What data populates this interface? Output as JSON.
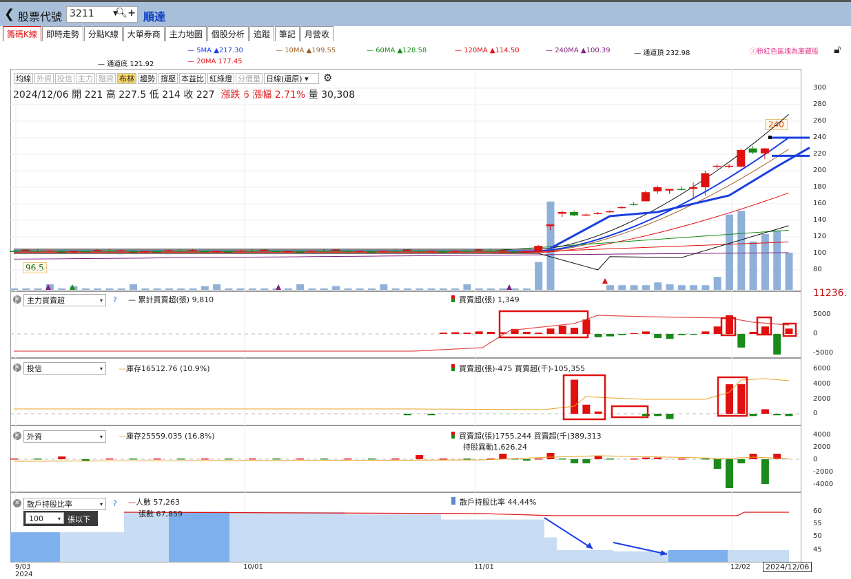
{
  "header": {
    "back": "❮",
    "label": "股票代號",
    "code": "3211",
    "name": "順達"
  },
  "tabs": [
    "籌碼K線",
    "即時走勢",
    "分點K線",
    "大單券商",
    "主力地圖",
    "個股分析",
    "追蹤",
    "筆記",
    "月營收"
  ],
  "ma_legend": {
    "ma5": "5MA ▲217.30",
    "ma10": "10MA ▲199.55",
    "ma60": "60MA ▲128.58",
    "ma120": "120MA ▲114.50",
    "ma240": "240MA ▲100.39",
    "channel_top": "通道頂 232.98",
    "channel_bottom": "通道底 121.92",
    "ma20": "20MA 177.45"
  },
  "warning": "ⓘ粉紅色區塊為庫藏股",
  "toolbar": [
    "均線",
    "外資",
    "投信",
    "主力",
    "融資",
    "布林",
    "趨勢",
    "撐壓",
    "本益比",
    "紅綠燈",
    "分價量",
    "日線(還原)"
  ],
  "ohlc": {
    "date": "2024/12/06",
    "open": "開 221",
    "high": "高 227.5",
    "low": "低 214",
    "close": "收 227",
    "change": "漲跌 6",
    "pct": "漲幅 2.71%",
    "vol": "量 30,308"
  },
  "price_labels": {
    "high_tag": "240",
    "low_tag": "96.5"
  },
  "price_axis": [
    "300",
    "280",
    "260",
    "240",
    "220",
    "200",
    "180",
    "160",
    "140",
    "120",
    "100",
    "80"
  ],
  "panel1": {
    "select": "主力買賣超",
    "q": "?",
    "legend": "累計買賣超(張) 9,810",
    "right": "買賣超(張) 1,349",
    "axis": [
      "5000",
      "0",
      "-5000"
    ],
    "edge": "11236."
  },
  "panel2": {
    "select": "投信",
    "legend": "庫存16512.76 (10.9%)",
    "right": "買賣超(張)-475 買賣超(千)-105,355",
    "axis": [
      "6000",
      "4000",
      "2000",
      "0"
    ]
  },
  "panel3": {
    "select": "外資",
    "legend": "庫存25559.035 (16.8%)",
    "right": "買賣超(張)1755.244 買賣超(千)389,313",
    "right2": "持股異動1,626.24",
    "axis": [
      "4000",
      "2000",
      "0",
      "-2000",
      "-4000"
    ]
  },
  "panel4": {
    "select": "散戶持股比率",
    "q": "?",
    "sub_select": "100",
    "sub_label": "張以下",
    "legend1": "人數 57,263",
    "legend2": "張數 67,859",
    "right": "散戶持股比率 44.44%",
    "axis": [
      "60",
      "55",
      "50",
      "45"
    ]
  },
  "x_dates": {
    "d1": "9/03",
    "d1y": "2024",
    "d2": "10/01",
    "d3": "11/01",
    "d4": "12/02",
    "current": "2024/12/06"
  },
  "colors": {
    "up": "#e01010",
    "down": "#1a8a1a",
    "volume": "#8fb0d8",
    "annotation": "#1a3ee0",
    "box": "#e01010"
  },
  "chart_data": {
    "type": "candlestick",
    "candles": [
      {
        "o": 175,
        "h": 182,
        "l": 172,
        "c": 180
      },
      {
        "o": 176,
        "h": 178,
        "l": 172,
        "c": 178
      },
      {
        "o": 178,
        "h": 181,
        "l": 176,
        "c": 177
      },
      {
        "o": 178,
        "h": 186,
        "l": 167,
        "c": 180
      },
      {
        "o": 180,
        "h": 200,
        "l": 170,
        "c": 197
      },
      {
        "o": 205,
        "h": 208,
        "l": 202,
        "c": 206
      },
      {
        "o": 206,
        "h": 208,
        "l": 203,
        "c": 206
      },
      {
        "o": 205,
        "h": 227,
        "l": 204,
        "c": 225
      },
      {
        "o": 227,
        "h": 230,
        "l": 220,
        "c": 222
      },
      {
        "o": 221,
        "h": 227.5,
        "l": 214,
        "c": 227
      }
    ],
    "investor_recent": [
      4500,
      1200,
      300,
      0,
      600,
      600,
      -400,
      -700
    ],
    "retail_ratio": [
      45,
      45,
      45,
      44.44
    ]
  }
}
